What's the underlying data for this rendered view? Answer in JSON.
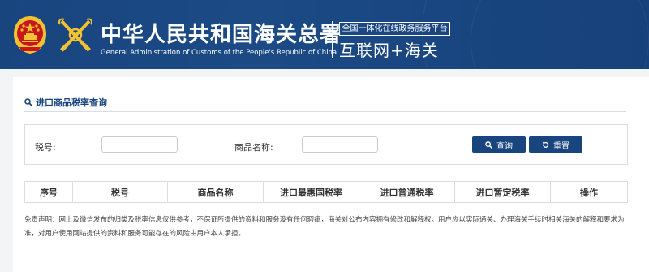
{
  "header": {
    "title_cn": "中华人民共和国海关总署",
    "title_en": "General Administration of Customs of the People's Republic of China",
    "platform_tag": "全国一体化在线政务服务平台",
    "internet_customs": "互联网+海关",
    "colors": {
      "header_bg": "#1b4a85",
      "accent": "#19457f",
      "emblem_red": "#c8161d",
      "emblem_gold": "#f2c230"
    }
  },
  "section": {
    "title": "进口商品税率查询",
    "icon": "search-icon"
  },
  "search": {
    "tax_number_label": "税号:",
    "tax_number_value": "",
    "product_name_label": "商品名称:",
    "product_name_value": "",
    "query_button": "查询",
    "query_icon": "search-icon",
    "reset_button": "重置",
    "reset_icon": "reset-icon"
  },
  "table": {
    "headers": [
      "序号",
      "税号",
      "商品名称",
      "进口最惠国税率",
      "进口普通税率",
      "进口暂定税率",
      "操作"
    ],
    "rows": []
  },
  "disclaimer": "免责声明：网上及微信发布的归类及税率信息仅供参考，不保证所提供的资料和服务没有任何瑕疵，海关对公布内容拥有修改和解释权。用户应以实际通关、办理海关手续时相关海关的解释和要求为准，对用户使用网站提供的资料和服务可能存在的风险由用户本人承担。"
}
